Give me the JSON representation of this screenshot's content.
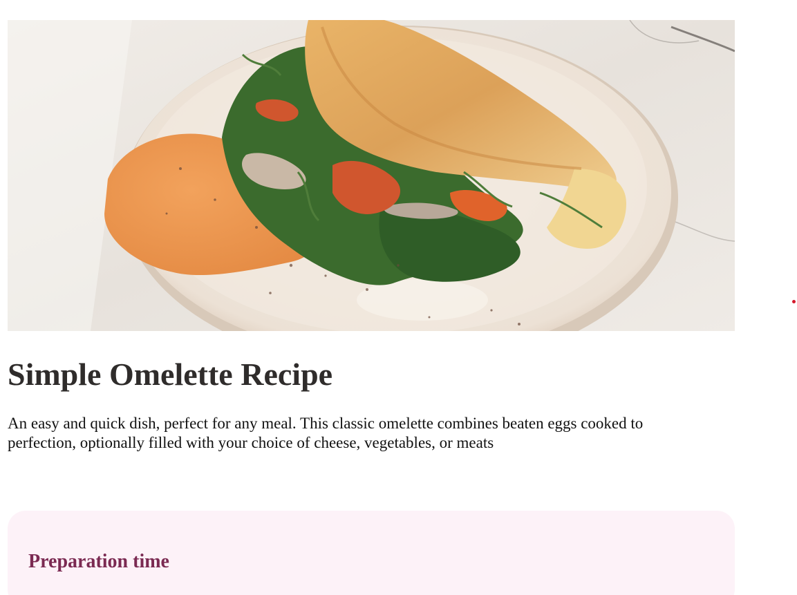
{
  "recipe": {
    "title": "Simple Omelette Recipe",
    "description": "An easy and quick dish, perfect for any meal. This classic omelette combines beaten eggs cooked to perfection, optionally filled with your choice of cheese, vegetables, or meats"
  },
  "preparation": {
    "heading": "Preparation time"
  },
  "colors": {
    "title": "#2f2c2b",
    "prep_card_background": "#fdf2f8",
    "prep_heading": "#7b2a52",
    "stray_dot": "#d4182b"
  },
  "hero_image": {
    "subject": "omelette-with-spinach-and-spread-photo"
  }
}
